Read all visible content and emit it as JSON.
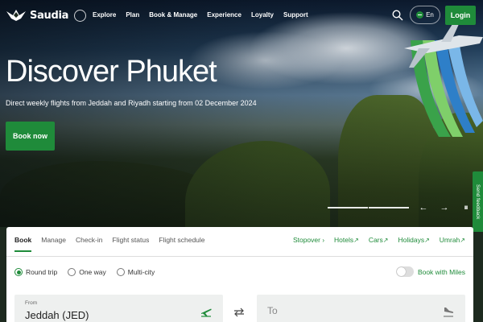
{
  "brand": {
    "name": "Saudia",
    "accent": "#1f8b3a"
  },
  "nav": {
    "items": [
      "Explore",
      "Plan",
      "Book & Manage",
      "Experience",
      "Loyalty",
      "Support"
    ],
    "language": "En",
    "login_label": "Login",
    "search_icon": "search-icon"
  },
  "hero": {
    "title": "Discover Phuket",
    "subtitle": "Direct weekly flights from Jeddah and Riyadh starting from 02 December 2024",
    "cta_label": "Book now"
  },
  "carousel": {
    "prev_icon": "←",
    "next_icon": "→",
    "pause_icon": "⏸"
  },
  "feedback": {
    "label": "Send feedback"
  },
  "booking": {
    "tabs": [
      {
        "label": "Book",
        "active": true
      },
      {
        "label": "Manage",
        "active": false
      },
      {
        "label": "Check-in",
        "active": false
      },
      {
        "label": "Flight status",
        "active": false
      },
      {
        "label": "Flight schedule",
        "active": false
      }
    ],
    "extras": [
      {
        "label": "Stopover",
        "arrow": "›"
      },
      {
        "label": "Hotels",
        "arrow": "↗"
      },
      {
        "label": "Cars",
        "arrow": "↗"
      },
      {
        "label": "Holidays",
        "arrow": "↗"
      },
      {
        "label": "Umrah",
        "arrow": "↗"
      }
    ],
    "trip_types": [
      {
        "label": "Round trip",
        "selected": true
      },
      {
        "label": "One way",
        "selected": false
      },
      {
        "label": "Multi-city",
        "selected": false
      }
    ],
    "miles_label": "Book with Miles",
    "miles_enabled": false,
    "from_label": "From",
    "from_value": "Jeddah (JED)",
    "to_placeholder": "To"
  }
}
